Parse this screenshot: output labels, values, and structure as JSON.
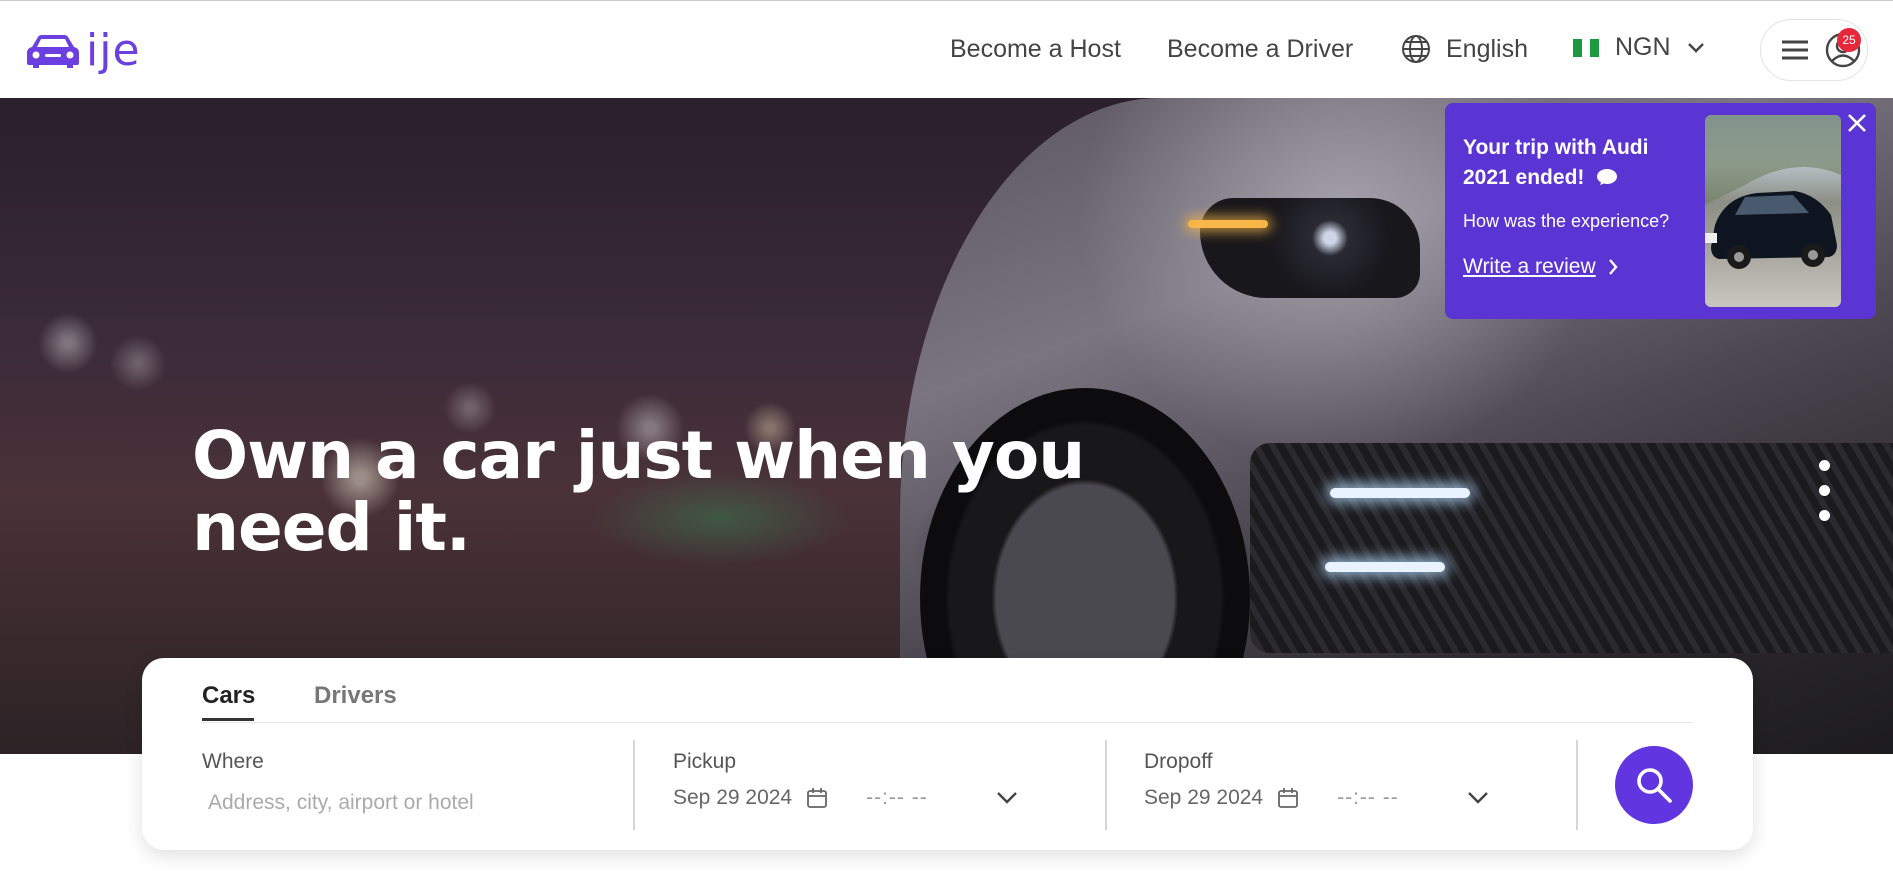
{
  "header": {
    "logo_text": "ije",
    "nav": {
      "become_host": "Become a Host",
      "become_driver": "Become a Driver"
    },
    "language": "English",
    "currency": "NGN",
    "notification_count": "25"
  },
  "hero": {
    "title": "Own a car just when you need it."
  },
  "review_popup": {
    "title": "Your trip with Audi 2021 ended!",
    "question": "How was the experience?",
    "link": "Write a review"
  },
  "search": {
    "tabs": [
      {
        "label": "Cars",
        "active": true
      },
      {
        "label": "Drivers",
        "active": false
      }
    ],
    "where": {
      "label": "Where",
      "placeholder": "Address, city, airport or hotel"
    },
    "pickup": {
      "label": "Pickup",
      "date": "Sep 29 2024",
      "time": "--:-- --"
    },
    "dropoff": {
      "label": "Dropoff",
      "date": "Sep 29 2024",
      "time": "--:-- --"
    }
  },
  "colors": {
    "brand": "#6136e0",
    "popup_bg": "#5a35d4",
    "badge": "#e6283a"
  }
}
